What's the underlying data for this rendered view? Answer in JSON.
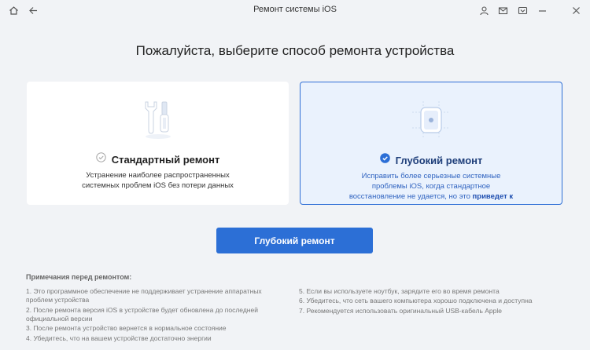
{
  "window": {
    "title": "Ремонт системы iOS"
  },
  "titlebar_icons": [
    "home-icon",
    "back-icon",
    "user-icon",
    "mail-icon",
    "dropdown-icon",
    "minimize-icon",
    "close-icon"
  ],
  "heading": "Пожалуйста, выберите способ ремонта устройства",
  "cards": [
    {
      "title": "Стандартный ремонт",
      "desc_line1": "Устранение наиболее распространенных",
      "desc_line2": "системных проблем iOS без потери данных",
      "selected": false
    },
    {
      "title": "Глубокий ремонт",
      "desc_line1": "Исправить более серьезные системные",
      "desc_line2": "проблемы iOS, когда стандартное",
      "desc_line3": "восстановление не удается, но это",
      "desc_bold": "приведет к",
      "selected": true
    }
  ],
  "action_button": "Глубокий ремонт",
  "notes": {
    "title": "Примечания перед ремонтом:",
    "left": [
      "1.  Это программное обеспечение не поддерживает устранение аппаратных проблем устройства",
      "2.  После ремонта версия iOS в устройстве будет обновлена до последней официальной версии",
      "3.  После ремонта устройство вернется в нормальное состояние",
      "4.  Убедитесь, что на вашем устройстве достаточно энергии"
    ],
    "right": [
      "5.  Если вы используете ноутбук, зарядите его во время ремонта",
      "6.  Убедитесь, что сеть вашего компьютера хорошо подключена и доступна",
      "7.  Рекомендуется использовать оригинальный USB-кабель Apple"
    ]
  },
  "colors": {
    "accent": "#2c6fd6",
    "selected_bg": "#eaf2fd",
    "page_bg": "#f1f3f6"
  }
}
